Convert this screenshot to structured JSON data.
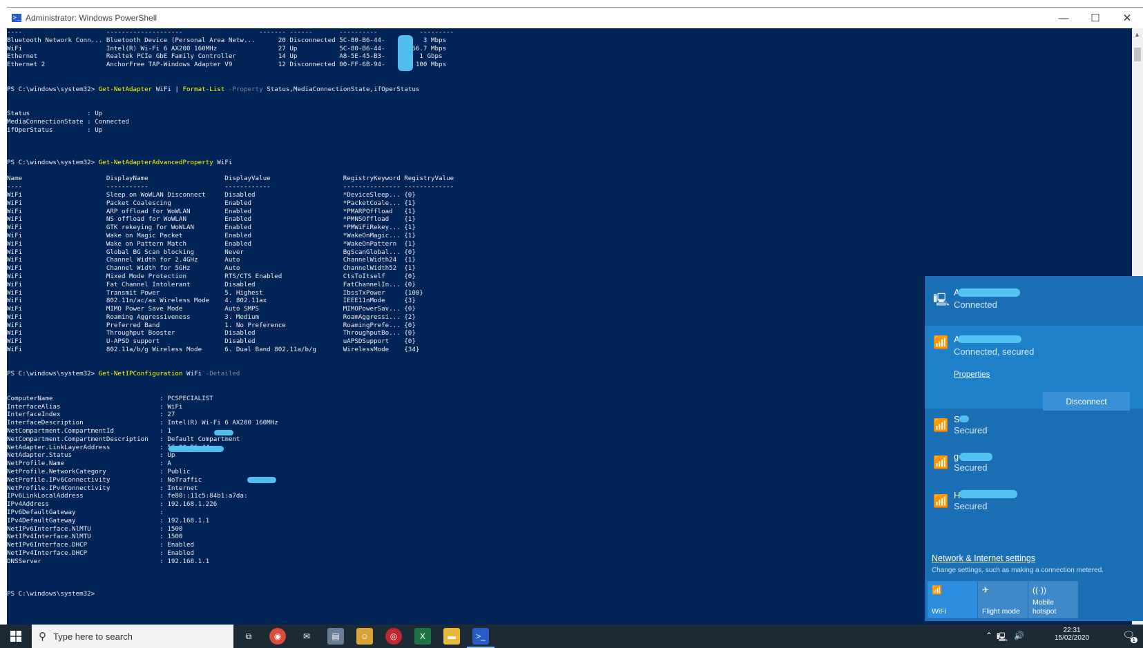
{
  "window": {
    "title": "Administrator: Windows PowerShell",
    "controls": {
      "minimize": "—",
      "maximize": "☐",
      "close": "✕"
    }
  },
  "terminal": {
    "lines": [
      {
        "t": "----                      --------------------                    ------- ------       ----------           ---------"
      },
      {
        "t": "Bluetooth Network Conn... Bluetooth Device (Personal Area Netw...      20 Disconnected 5C-80-B6-44-          3 Mbps"
      },
      {
        "t": "WiFi                      Intel(R) Wi-Fi 6 AX200 160MHz                27 Up           5C-80-B6-44-      866.7 Mbps"
      },
      {
        "t": "Ethernet                  Realtek PCIe GbE Family Controller           14 Up           A8-5E-45-B3-         1 Gbps"
      },
      {
        "t": "Ethernet 2                AnchorFree TAP-Windows Adapter V9            12 Disconnected 00-FF-6B-94-        100 Mbps"
      },
      {
        "t": ""
      },
      {
        "t": ""
      },
      {
        "parts": [
          [
            "PS C:\\windows\\system32> ",
            ""
          ],
          [
            "Get-NetAdapter",
            "y"
          ],
          [
            " WiFi | ",
            ""
          ],
          [
            "Format-List",
            "y"
          ],
          [
            " -Property",
            "g"
          ],
          [
            " Status,MediaConnectionState,ifOperStatus",
            ""
          ]
        ]
      },
      {
        "t": ""
      },
      {
        "t": ""
      },
      {
        "t": "Status               : Up"
      },
      {
        "t": "MediaConnectionState : Connected"
      },
      {
        "t": "ifOperStatus         : Up"
      },
      {
        "t": ""
      },
      {
        "t": ""
      },
      {
        "t": ""
      },
      {
        "parts": [
          [
            "PS C:\\windows\\system32> ",
            ""
          ],
          [
            "Get-NetAdapterAdvancedProperty",
            "y"
          ],
          [
            " WiFi",
            ""
          ]
        ]
      },
      {
        "t": ""
      },
      {
        "t": "Name                      DisplayName                    DisplayValue                   RegistryKeyword RegistryValue"
      },
      {
        "t": "----                      -----------                    ------------                   --------------- -------------"
      },
      {
        "t": "WiFi                      Sleep on WoWLAN Disconnect     Disabled                       *DeviceSleep... {0}"
      },
      {
        "t": "WiFi                      Packet Coalescing              Enabled                        *PacketCoale... {1}"
      },
      {
        "t": "WiFi                      ARP offload for WoWLAN         Enabled                        *PMARPOffload   {1}"
      },
      {
        "t": "WiFi                      NS offload for WoWLAN          Enabled                        *PMNSOffload    {1}"
      },
      {
        "t": "WiFi                      GTK rekeying for WoWLAN        Enabled                        *PMWiFiRekey... {1}"
      },
      {
        "t": "WiFi                      Wake on Magic Packet           Enabled                        *WakeOnMagic... {1}"
      },
      {
        "t": "WiFi                      Wake on Pattern Match          Enabled                        *WakeOnPattern  {1}"
      },
      {
        "t": "WiFi                      Global BG Scan blocking        Never                          BgScanGlobal... {0}"
      },
      {
        "t": "WiFi                      Channel Width for 2.4GHz       Auto                           ChannelWidth24  {1}"
      },
      {
        "t": "WiFi                      Channel Width for 5GHz         Auto                           ChannelWidth52  {1}"
      },
      {
        "t": "WiFi                      Mixed Mode Protection          RTS/CTS Enabled                CtsToItself     {0}"
      },
      {
        "t": "WiFi                      Fat Channel Intolerant         Disabled                       FatChannelIn... {0}"
      },
      {
        "t": "WiFi                      Transmit Power                 5. Highest                     IbssTxPower     {100}"
      },
      {
        "t": "WiFi                      802.11n/ac/ax Wireless Mode    4. 802.11ax                    IEEE11nMode     {3}"
      },
      {
        "t": "WiFi                      MIMO Power Save Mode           Auto SMPS                      MIMOPowerSav... {0}"
      },
      {
        "t": "WiFi                      Roaming Aggressiveness         3. Medium                      RoamAggressi... {2}"
      },
      {
        "t": "WiFi                      Preferred Band                 1. No Preference               RoamingPrefe... {0}"
      },
      {
        "t": "WiFi                      Throughput Booster             Disabled                       ThroughputBo... {0}"
      },
      {
        "t": "WiFi                      U-APSD support                 Disabled                       uAPSDSupport    {0}"
      },
      {
        "t": "WiFi                      802.11a/b/g Wireless Mode      6. Dual Band 802.11a/b/g       WirelessMode    {34}"
      },
      {
        "t": ""
      },
      {
        "t": ""
      },
      {
        "parts": [
          [
            "PS C:\\windows\\system32> ",
            ""
          ],
          [
            "Get-NetIPConfiguration",
            "y"
          ],
          [
            " WiFi ",
            ""
          ],
          [
            "-Detailed",
            "g"
          ]
        ]
      },
      {
        "t": ""
      },
      {
        "t": ""
      },
      {
        "t": "ComputerName                            : PCSPECIALIST"
      },
      {
        "t": "InterfaceAlias                          : WiFi"
      },
      {
        "t": "InterfaceIndex                          : 27"
      },
      {
        "t": "InterfaceDescription                    : Intel(R) Wi-Fi 6 AX200 160MHz"
      },
      {
        "t": "NetCompartment.CompartmentId            : 1"
      },
      {
        "t": "NetCompartment.CompartmentDescription   : Default Compartment"
      },
      {
        "t": "NetAdapter.LinkLayerAddress             : 5C-80-B6-44-"
      },
      {
        "t": "NetAdapter.Status                       : Up"
      },
      {
        "t": "NetProfile.Name                         : A"
      },
      {
        "t": "NetProfile.NetworkCategory              : Public"
      },
      {
        "t": "NetProfile.IPv6Connectivity             : NoTraffic"
      },
      {
        "t": "NetProfile.IPv4Connectivity             : Internet"
      },
      {
        "t": "IPv6LinkLocalAddress                    : fe80::11c5:84b1:a7da:"
      },
      {
        "t": "IPv4Address                             : 192.168.1.226"
      },
      {
        "t": "IPv6DefaultGateway                      :"
      },
      {
        "t": "IPv4DefaultGateway                      : 192.168.1.1"
      },
      {
        "t": "NetIPv6Interface.NlMTU                  : 1500"
      },
      {
        "t": "NetIPv4Interface.NlMTU                  : 1500"
      },
      {
        "t": "NetIPv6Interface.DHCP                   : Enabled"
      },
      {
        "t": "NetIPv4Interface.DHCP                   : Enabled"
      },
      {
        "t": "DNSServer                               : 192.168.1.1"
      },
      {
        "t": ""
      },
      {
        "t": ""
      },
      {
        "t": ""
      },
      {
        "t": "PS C:\\windows\\system32>"
      }
    ]
  },
  "flyout": {
    "networks": [
      {
        "name": "A",
        "state": "Connected",
        "icon": "ethernet-icon"
      },
      {
        "name": "A",
        "state": "Connected, secured",
        "icon": "wifi-icon",
        "properties": "Properties",
        "action": "Disconnect"
      },
      {
        "name": "S",
        "state": "Secured",
        "icon": "wifi-icon"
      },
      {
        "name": "g",
        "state": "Secured",
        "icon": "wifi-icon"
      },
      {
        "name": "H",
        "state": "Secured",
        "icon": "wifi-icon"
      }
    ],
    "settings_link": "Network & Internet settings",
    "settings_sub": "Change settings, such as making a connection metered.",
    "quick_actions": [
      {
        "label": "WiFi",
        "icon": "wifi-icon",
        "active": true
      },
      {
        "label": "Flight mode",
        "icon": "airplane-icon",
        "active": false
      },
      {
        "label": "Mobile\nhotspot",
        "icon": "hotspot-icon",
        "active": false
      }
    ]
  },
  "taskbar": {
    "search_placeholder": "Type here to search",
    "time": "22:31",
    "date": "15/02/2020",
    "notification_count": "1"
  },
  "colors": {
    "terminal_bg": "#012456",
    "command_yellow": "#ffff00",
    "flyout_bg": "#1a6fb5",
    "taskbar_bg": "#1c2a36"
  }
}
